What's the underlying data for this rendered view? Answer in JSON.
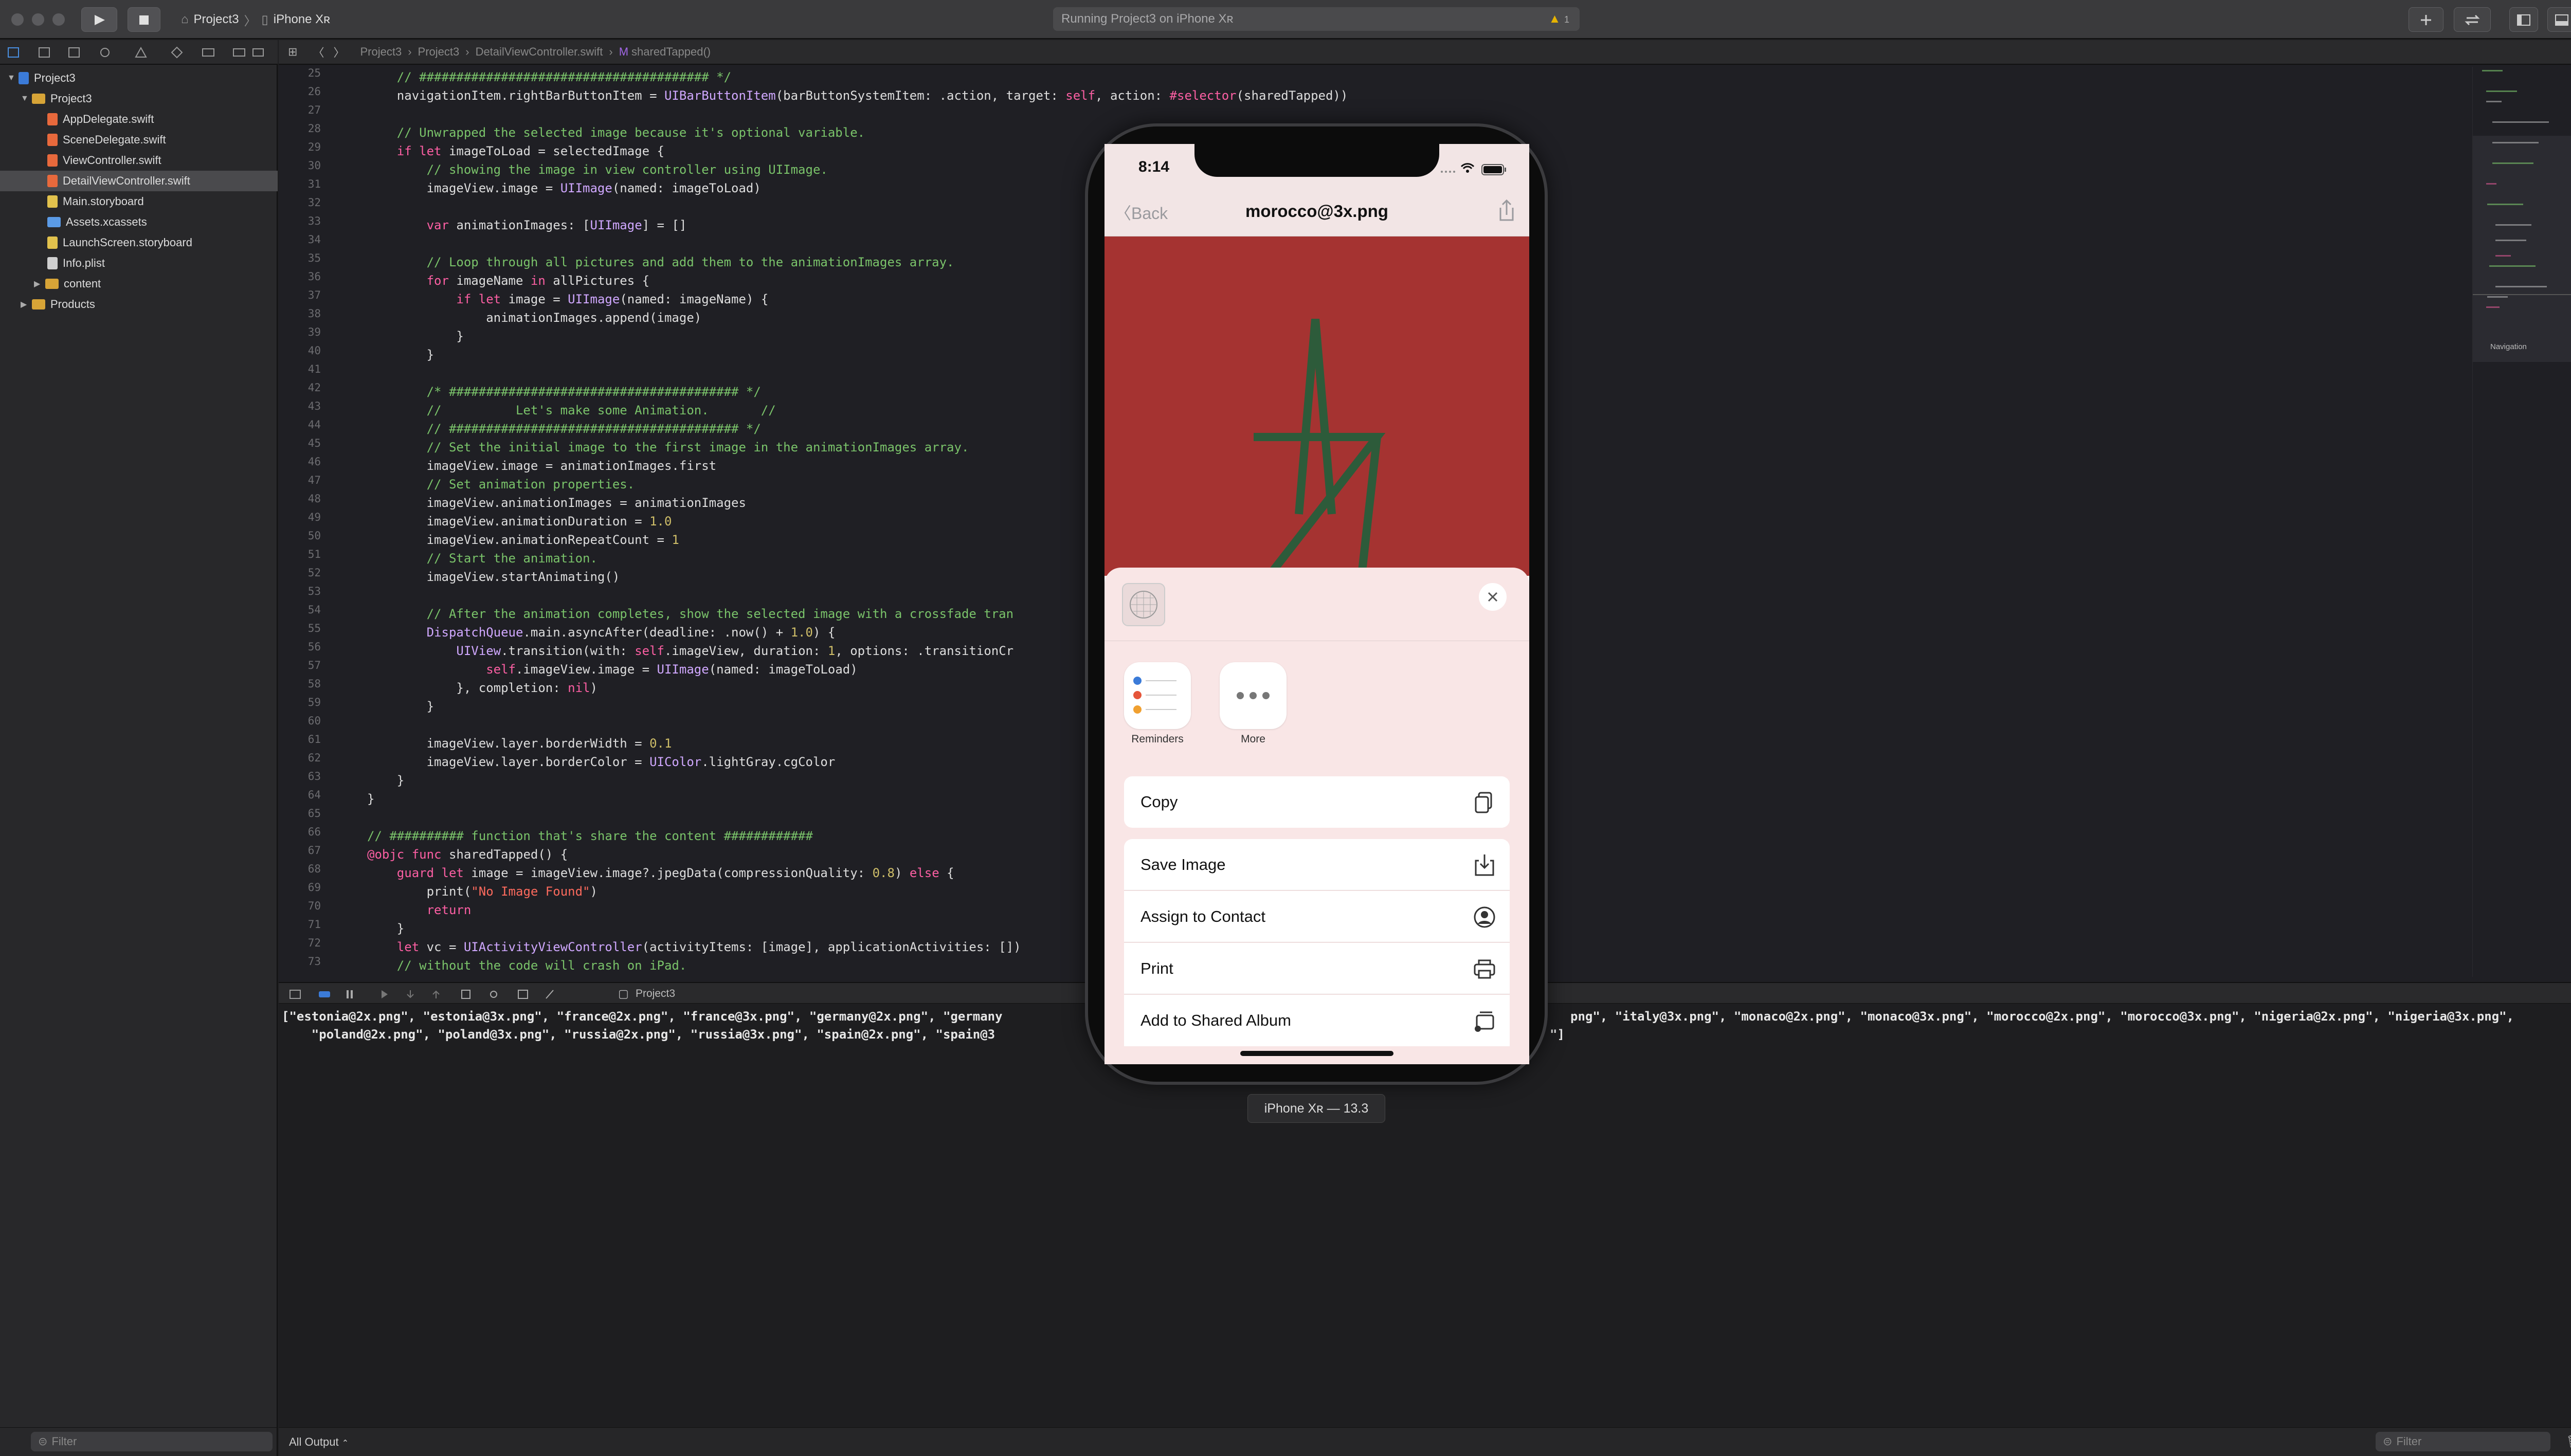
{
  "toolbar": {
    "scheme_project": "Project3",
    "scheme_device": "iPhone Xʀ",
    "activity_text": "Running Project3 on iPhone Xʀ",
    "warning_count": "1"
  },
  "navigator": {
    "items": [
      {
        "label": "Project3",
        "kind": "project"
      },
      {
        "label": "Project3",
        "kind": "folder"
      },
      {
        "label": "AppDelegate.swift",
        "kind": "file"
      },
      {
        "label": "SceneDelegate.swift",
        "kind": "file"
      },
      {
        "label": "ViewController.swift",
        "kind": "file"
      },
      {
        "label": "DetailViewController.swift",
        "kind": "file",
        "selected": true
      },
      {
        "label": "Main.storyboard",
        "kind": "file"
      },
      {
        "label": "Assets.xcassets",
        "kind": "folder-blue"
      },
      {
        "label": "LaunchScreen.storyboard",
        "kind": "file"
      },
      {
        "label": "Info.plist",
        "kind": "file"
      },
      {
        "label": "content",
        "kind": "folder"
      },
      {
        "label": "Products",
        "kind": "folder"
      }
    ],
    "filter_placeholder": "Filter"
  },
  "jumpbar": {
    "crumbs": [
      "Project3",
      "Project3",
      "DetailViewController.swift",
      "sharedTapped()"
    ]
  },
  "editor": {
    "line_numbers": [
      "25",
      "26",
      "27",
      "28",
      "29",
      "30",
      "31",
      "32",
      "33",
      "34",
      "35",
      "36",
      "37",
      "38",
      "39",
      "40",
      "41",
      "42",
      "43",
      "44",
      "45",
      "46",
      "47",
      "48",
      "49",
      "50",
      "51",
      "52",
      "53",
      "54",
      "55",
      "56",
      "57",
      "58",
      "59",
      "60",
      "61",
      "62",
      "63",
      "64",
      "65",
      "66",
      "67",
      "68",
      "69",
      "70",
      "71",
      "72",
      "73"
    ],
    "lines": [
      "    // ####################################### */",
      "    navigationItem.rightBarButtonItem = UIBarButtonItem(barButtonSystemItem: .action, target: self, action: #selector(sharedTapped))",
      "",
      "    // Unwrapped the selected image because it's optional variable.",
      "    if let imageToLoad = selectedImage {",
      "        // showing the image in view controller using UIImage.",
      "        imageView.image = UIImage(named: imageToLoad)",
      "",
      "        var animationImages: [UIImage] = []",
      "",
      "        // Loop through all pictures and add them to the animationImages array.",
      "        for imageName in allPictures {",
      "            if let image = UIImage(named: imageName) {",
      "                animationImages.append(image)",
      "            }",
      "        }",
      "",
      "        /* ####################################### */",
      "        //          Let's make some Animation.       //",
      "        // ####################################### */",
      "        // Set the initial image to the first image in the animationImages array.",
      "        imageView.image = animationImages.first",
      "        // Set animation properties.",
      "        imageView.animationImages = animationImages",
      "        imageView.animationDuration = 1.0",
      "        imageView.animationRepeatCount = 1",
      "        // Start the animation.",
      "        imageView.startAnimating()",
      "",
      "        // After the animation completes, show the selected image with a crossfade tran",
      "        DispatchQueue.main.asyncAfter(deadline: .now() + 1.0) {",
      "            UIView.transition(with: self.imageView, duration: 1, options: .transitionCr",
      "                self.imageView.image = UIImage(named: imageToLoad)",
      "            }, completion: nil)",
      "        }",
      "",
      "        imageView.layer.borderWidth = 0.1",
      "        imageView.layer.borderColor = UIColor.lightGray.cgColor",
      "    }",
      "}",
      "",
      "// ########## function that's share the content ############",
      "@objc func sharedTapped() {",
      "    guard let image = imageView.image?.jpegData(compressionQuality: 0.8) else {",
      "        print(\"No Image Found\")",
      "        return",
      "    }",
      "    let vc = UIActivityViewController(activityItems: [image], applicationActivities: [])",
      "    // without the code will crash on iPad."
    ],
    "minimap_label": "Navigation"
  },
  "debug": {
    "target": "Project3",
    "output_line1_left": "[\"estonia@2x.png\", \"estonia@3x.png\", \"france@2x.png\", \"france@3x.png\", \"germany@2x.png\", \"germany",
    "output_line1_right": "png\", \"italy@3x.png\", \"monaco@2x.png\", \"monaco@3x.png\", \"morocco@2x.png\", \"morocco@3x.png\", \"nigeria@2x.png\", \"nigeria@3x.png\",",
    "output_line2_left": "    \"poland@2x.png\", \"poland@3x.png\", \"russia@2x.png\", \"russia@3x.png\", \"spain@2x.png\", \"spain@3",
    "output_line2_right": "\"]",
    "output_selector": "All Output",
    "filter_placeholder": "Filter"
  },
  "simulator": {
    "time": "8:14",
    "back_label": "Back",
    "title": "morocco@3x.png",
    "apps": [
      {
        "label": "Reminders"
      },
      {
        "label": "More"
      }
    ],
    "actions": [
      {
        "label": "Copy",
        "icon": "copy-icon"
      },
      {
        "label": "Save Image",
        "icon": "save-image-icon"
      },
      {
        "label": "Assign to Contact",
        "icon": "contact-icon"
      },
      {
        "label": "Print",
        "icon": "print-icon"
      },
      {
        "label": "Add to Shared Album",
        "icon": "shared-album-icon"
      }
    ],
    "device_label": "iPhone Xʀ — 13.3",
    "flag_color": "#a53331",
    "star_color": "#2d5b3a"
  }
}
